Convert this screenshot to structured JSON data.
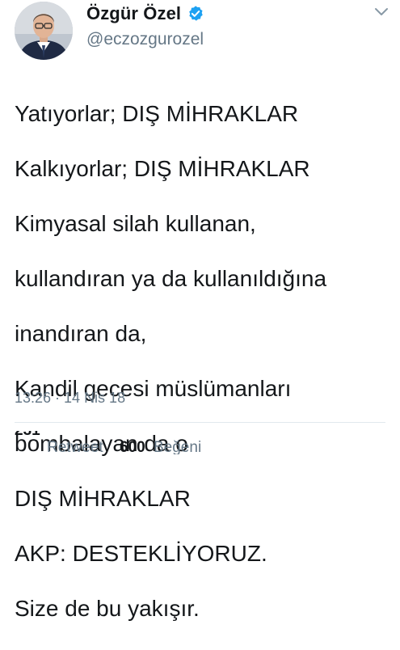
{
  "header": {
    "display_name": "Özgür Özel",
    "handle": "@eczozgurozel",
    "verified_icon": "verified-badge-icon",
    "menu_icon": "chevron-down-icon",
    "accent_color": "#1da1f2"
  },
  "tweet": {
    "lines": [
      "Yatıyorlar; DIŞ MİHRAKLAR",
      "Kalkıyorlar; DIŞ MİHRAKLAR",
      "Kimyasal silah kullanan,",
      "kullandıran ya da kullanıldığına",
      "inandıran da,",
      "Kandil gecesi müslümanları",
      "bombalayan da o",
      "DIŞ MİHRAKLAR",
      "AKP: DESTEKLİYORUZ.",
      "Size de bu yakışır."
    ],
    "timestamp": "13:26 · 14 Nis 18"
  },
  "stats": {
    "retweet_count": "231",
    "retweet_label": "Retweet",
    "like_count": "600",
    "like_label": "Beğeni"
  }
}
